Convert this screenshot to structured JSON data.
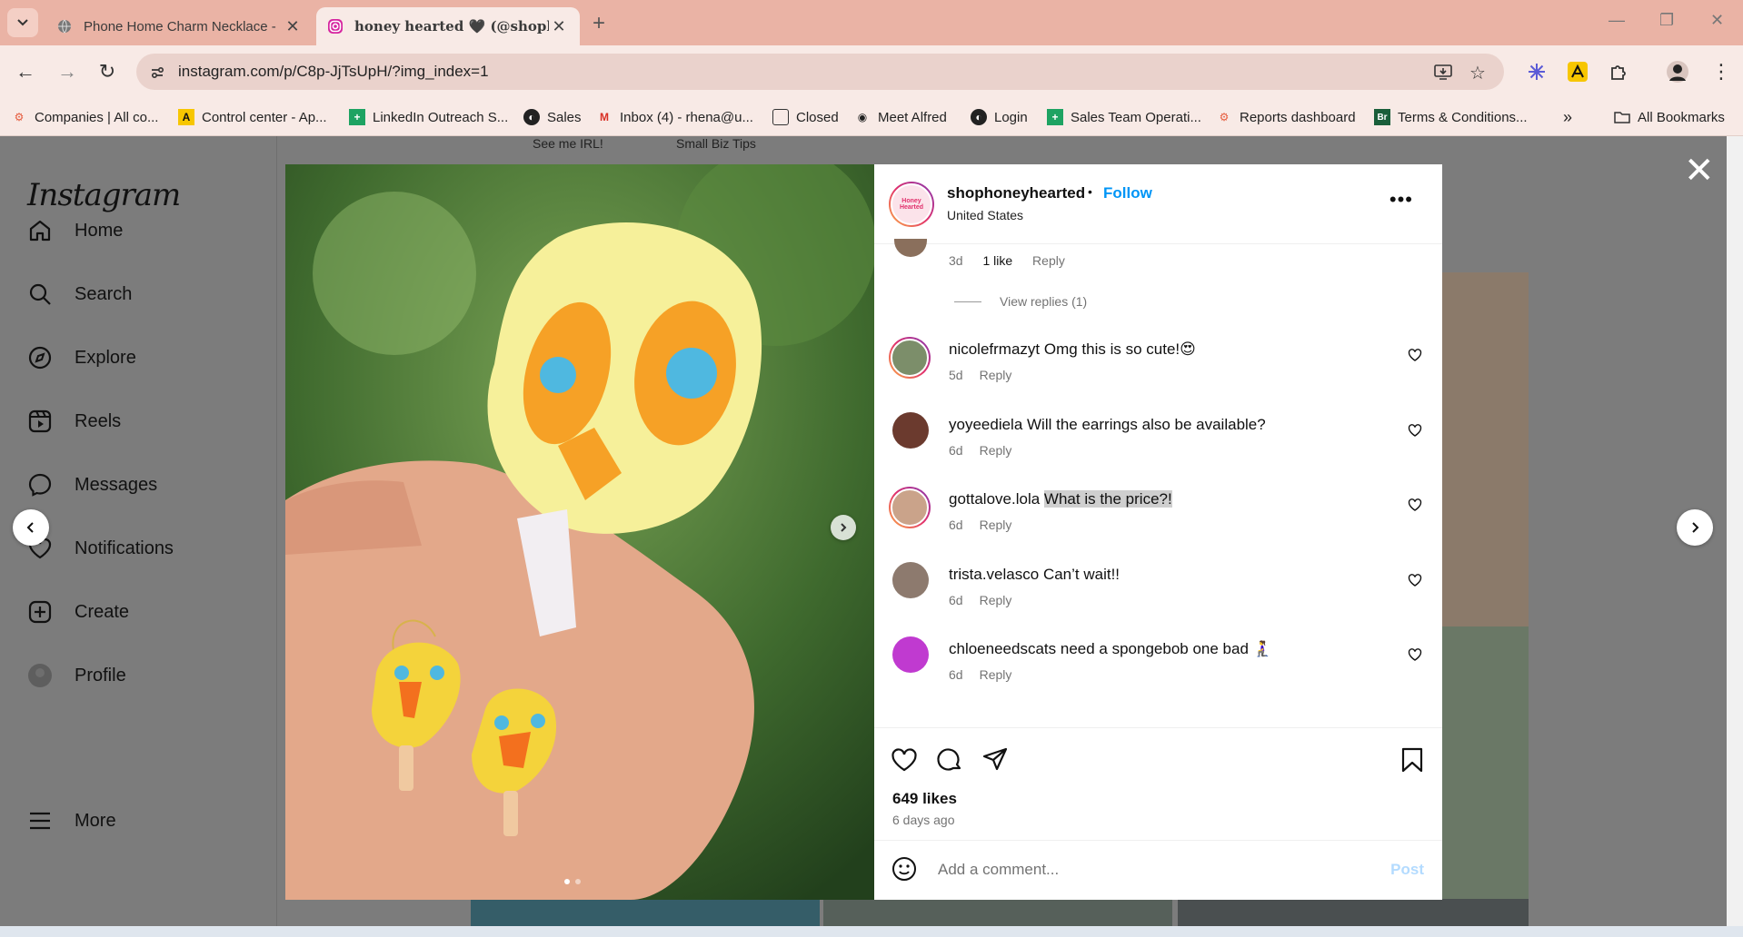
{
  "browser": {
    "tabs": [
      {
        "title": "Phone Home Charm Necklace -",
        "active": false
      },
      {
        "title": "honey hearted 🖤 (@shophoneyhearted)",
        "active": true
      }
    ],
    "url": "instagram.com/p/C8p-JjTsUpH/?img_index=1",
    "bookmarks": [
      "Companies | All co...",
      "Control center - Ap...",
      "LinkedIn Outreach S...",
      "Sales",
      "Inbox (4) - rhena@u...",
      "Closed",
      "Meet Alfred",
      "Login",
      "Sales Team Operati...",
      "Reports dashboard",
      "Terms & Conditions..."
    ],
    "all_bookmarks": "All Bookmarks"
  },
  "instagram": {
    "logo": "Instagram",
    "nav": [
      "Home",
      "Search",
      "Explore",
      "Reels",
      "Messages",
      "Notifications",
      "Create",
      "Profile"
    ],
    "more": "More",
    "background_tabs": [
      "See me IRL!",
      "Small Biz Tips"
    ]
  },
  "post": {
    "username": "shophoneyhearted",
    "separator": "•",
    "follow": "Follow",
    "location": "United States",
    "avatar_text": "Honey Hearted",
    "partial_comment": {
      "time": "3d",
      "likes": "1 like",
      "reply": "Reply"
    },
    "view_replies": "View replies (1)",
    "comments": [
      {
        "user": "nicolefrmazyt",
        "text": "Omg this is so cute!😍",
        "time": "5d",
        "reply": "Reply"
      },
      {
        "user": "yoyeediela",
        "text": "Will the earrings also be available?",
        "time": "6d",
        "reply": "Reply"
      },
      {
        "user": "gottalove.lola",
        "text": "What is the price?!",
        "time": "6d",
        "reply": "Reply"
      },
      {
        "user": "trista.velasco",
        "text": "Can’t wait!!",
        "time": "6d",
        "reply": "Reply"
      },
      {
        "user": "chloeneedscats",
        "text": "need a spongebob one bad 🧎‍♀️",
        "time": "6d",
        "reply": "Reply"
      }
    ],
    "likes": "649 likes",
    "posted": "6 days ago",
    "comment_placeholder": "Add a comment...",
    "post_button": "Post"
  }
}
